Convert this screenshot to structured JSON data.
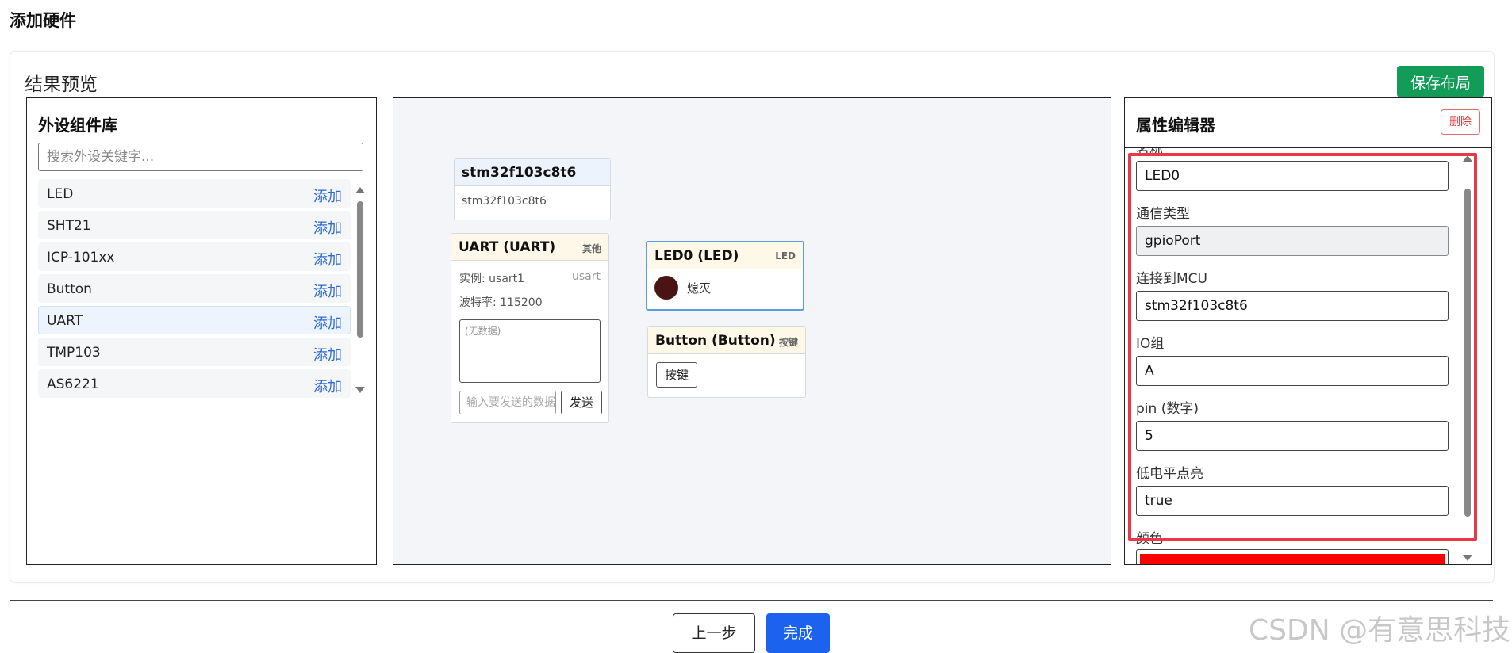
{
  "page_title": "添加硬件",
  "card": {
    "title": "结果预览",
    "save_label": "保存布局"
  },
  "library": {
    "title": "外设组件库",
    "search_placeholder": "搜索外设关键字...",
    "add_label": "添加",
    "items": [
      {
        "name": "LED"
      },
      {
        "name": "SHT21"
      },
      {
        "name": "ICP-101xx"
      },
      {
        "name": "Button"
      },
      {
        "name": "UART"
      },
      {
        "name": "TMP103"
      },
      {
        "name": "AS6221"
      }
    ]
  },
  "canvas": {
    "mcu": {
      "title": "stm32f103c8t6",
      "subtitle": "stm32f103c8t6"
    },
    "uart": {
      "title": "UART (UART)",
      "tag": "其他",
      "instance": "实例: usart1",
      "instance_tag": "usart",
      "baud": "波特率: 115200",
      "textarea": "(无数据)",
      "input_placeholder": "输入要发送的数据",
      "send_label": "发送"
    },
    "led": {
      "title": "LED0 (LED)",
      "tag": "LED",
      "state": "熄灭",
      "led_color": "#4a1414"
    },
    "button": {
      "title": "Button (Button)",
      "tag": "按键",
      "button_label": "按键"
    }
  },
  "properties": {
    "title": "属性编辑器",
    "delete_label": "删除",
    "fields": {
      "name_label": "名称",
      "name_value": "LED0",
      "comm_label": "通信类型",
      "comm_value": "gpioPort",
      "mcu_label": "连接到MCU",
      "mcu_value": "stm32f103c8t6",
      "io_label": "IO组",
      "io_value": "A",
      "pin_label": "pin (数字)",
      "pin_value": "5",
      "low_label": "低电平点亮",
      "low_value": "true",
      "color_label": "颜色",
      "color_value": "#ff0000"
    }
  },
  "footer": {
    "prev_label": "上一步",
    "done_label": "完成"
  },
  "watermark": "CSDN @有意思科技"
}
